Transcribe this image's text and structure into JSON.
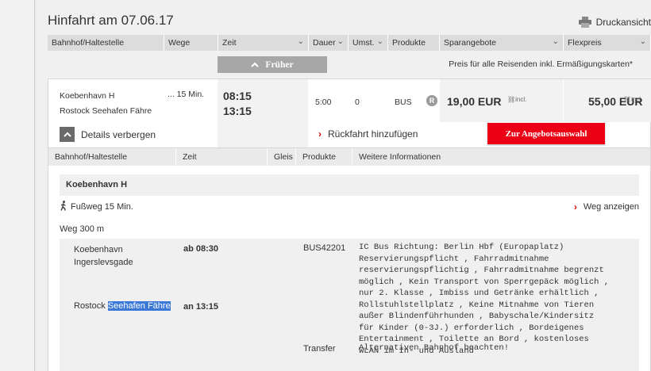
{
  "header": {
    "title": "Hinfahrt am 07.06.17",
    "print_label": "Druckansicht"
  },
  "columns": [
    {
      "label": "Bahnhof/Haltestelle",
      "has_dropdown": false
    },
    {
      "label": "Wege",
      "has_dropdown": false
    },
    {
      "label": "Zeit",
      "has_dropdown": true
    },
    {
      "label": "Dauer",
      "has_dropdown": true
    },
    {
      "label": "Umst.",
      "has_dropdown": true
    },
    {
      "label": "Produkte",
      "has_dropdown": false
    },
    {
      "label": "Sparangebote",
      "has_dropdown": true
    },
    {
      "label": "Flexpreis",
      "has_dropdown": true
    }
  ],
  "earlier_button": "Früher",
  "price_note": "Preis für alle Reisenden inkl. Ermäßigungskarten*",
  "connection": {
    "from": "Koebenhavn H",
    "to": "Rostock Seehafen Fähre",
    "walk": "... 15 Min.",
    "dep": "08:15",
    "arr": "13:15",
    "duration": "5:00",
    "changes": "0",
    "product": "BUS",
    "product_badge": "R",
    "saver_price": "19,00 EUR",
    "flex_price": "55,00 EUR",
    "incl": "incl.",
    "details_label": "Details verbergen",
    "return_label": "Rückfahrt hinzufügen",
    "cta_label": "Zur Angebotsauswahl"
  },
  "detail_columns": [
    "Bahnhof/Haltestelle",
    "Zeit",
    "Gleis",
    "Produkte",
    "Weitere Informationen"
  ],
  "detail": {
    "station": "Koebenhavn H",
    "footway": "Fußweg 15 Min.",
    "show_way": "Weg anzeigen",
    "way": "Weg 300 m",
    "leg": {
      "from": "Koebenhavn Ingerslevsgade",
      "dep": "ab 08:30",
      "to_plain": "Rostock ",
      "to_selected": "Seehafen Fähre",
      "arr": "an 13:15",
      "product": "BUS42201",
      "info": "IC Bus Richtung: Berlin Hbf (Europaplatz) Reservierungspflicht , Fahrradmitnahme reservierungspflichtig , Fahrradmitnahme begrenzt möglich , Kein Transport von Sperrgepäck möglich , nur 2. Klasse , Imbiss und Getränke erhältlich , Rollstuhlstellplatz , Keine Mitnahme von Tieren außer Blindenführhunden , Babyschale/Kindersitz für Kinder (0-3J.) erforderlich , Bordeigenes Entertainment , Toilette an Bord , kostenloses WLAN im In- und Ausland",
      "transfer": "Transfer",
      "transfer_note": "Alternativen Bahnhof beachten!"
    }
  },
  "colors": {
    "cta": "#ec0016",
    "selection": "#3b78d8",
    "header_bg": "#dcdcdc"
  }
}
